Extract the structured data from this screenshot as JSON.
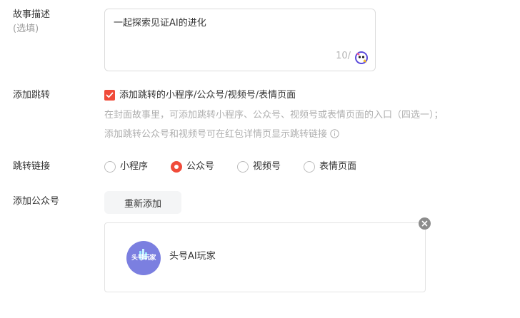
{
  "story": {
    "label": "故事描述",
    "sublabel": "(选填)",
    "text": "一起探索见证AI的进化",
    "counter": "10/",
    "assistant_icon": "ai-assistant-icon"
  },
  "jump": {
    "label": "添加跳转",
    "checkbox_label": "添加跳转的小程序/公众号/视频号/表情页面",
    "checked": true,
    "hint_line1": "在封面故事里，可添加跳转小程序、公众号、视频号或表情页面的入口（四选一）；",
    "hint_line2": "添加跳转公众号和视频号可在红包详情页显示跳转链接",
    "info_icon": "info-icon"
  },
  "link": {
    "label": "跳转链接",
    "options": [
      "小程序",
      "公众号",
      "视频号",
      "表情页面"
    ],
    "selected": "公众号"
  },
  "official_account": {
    "label": "添加公众号",
    "readd_label": "重新添加",
    "avatar_text": "头号玩家",
    "name": "头号AI玩家",
    "remove_icon": "close-icon"
  },
  "colors": {
    "accent": "#f04b3a",
    "avatar_bg": "#7b7fe0",
    "hint": "#b0b0b0"
  }
}
